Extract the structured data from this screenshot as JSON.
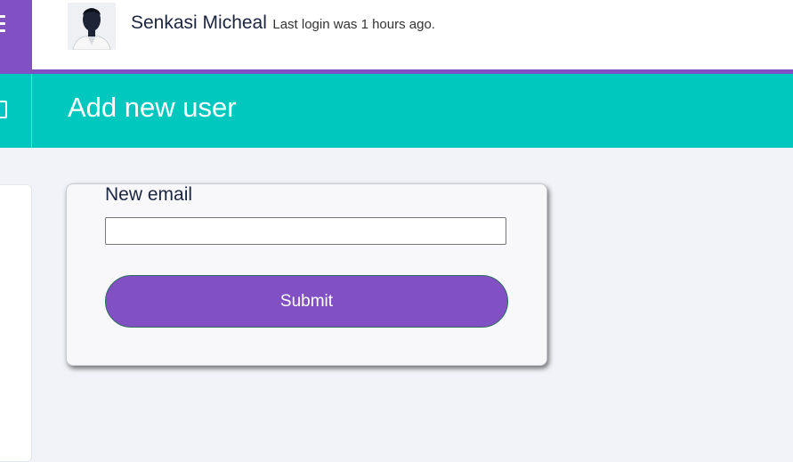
{
  "header": {
    "menu_icon": "hamburger-menu-icon",
    "user_name": "Senkasi Micheal",
    "last_login": "Last login was 1 hours ago."
  },
  "titlebar": {
    "title": "Add new user"
  },
  "form": {
    "email_label": "New email",
    "email_value": "",
    "email_placeholder": "",
    "submit_label": "Submit"
  },
  "colors": {
    "accent_purple": "#8150c2",
    "title_teal": "#00c8be",
    "page_background": "#f2f3f8"
  }
}
